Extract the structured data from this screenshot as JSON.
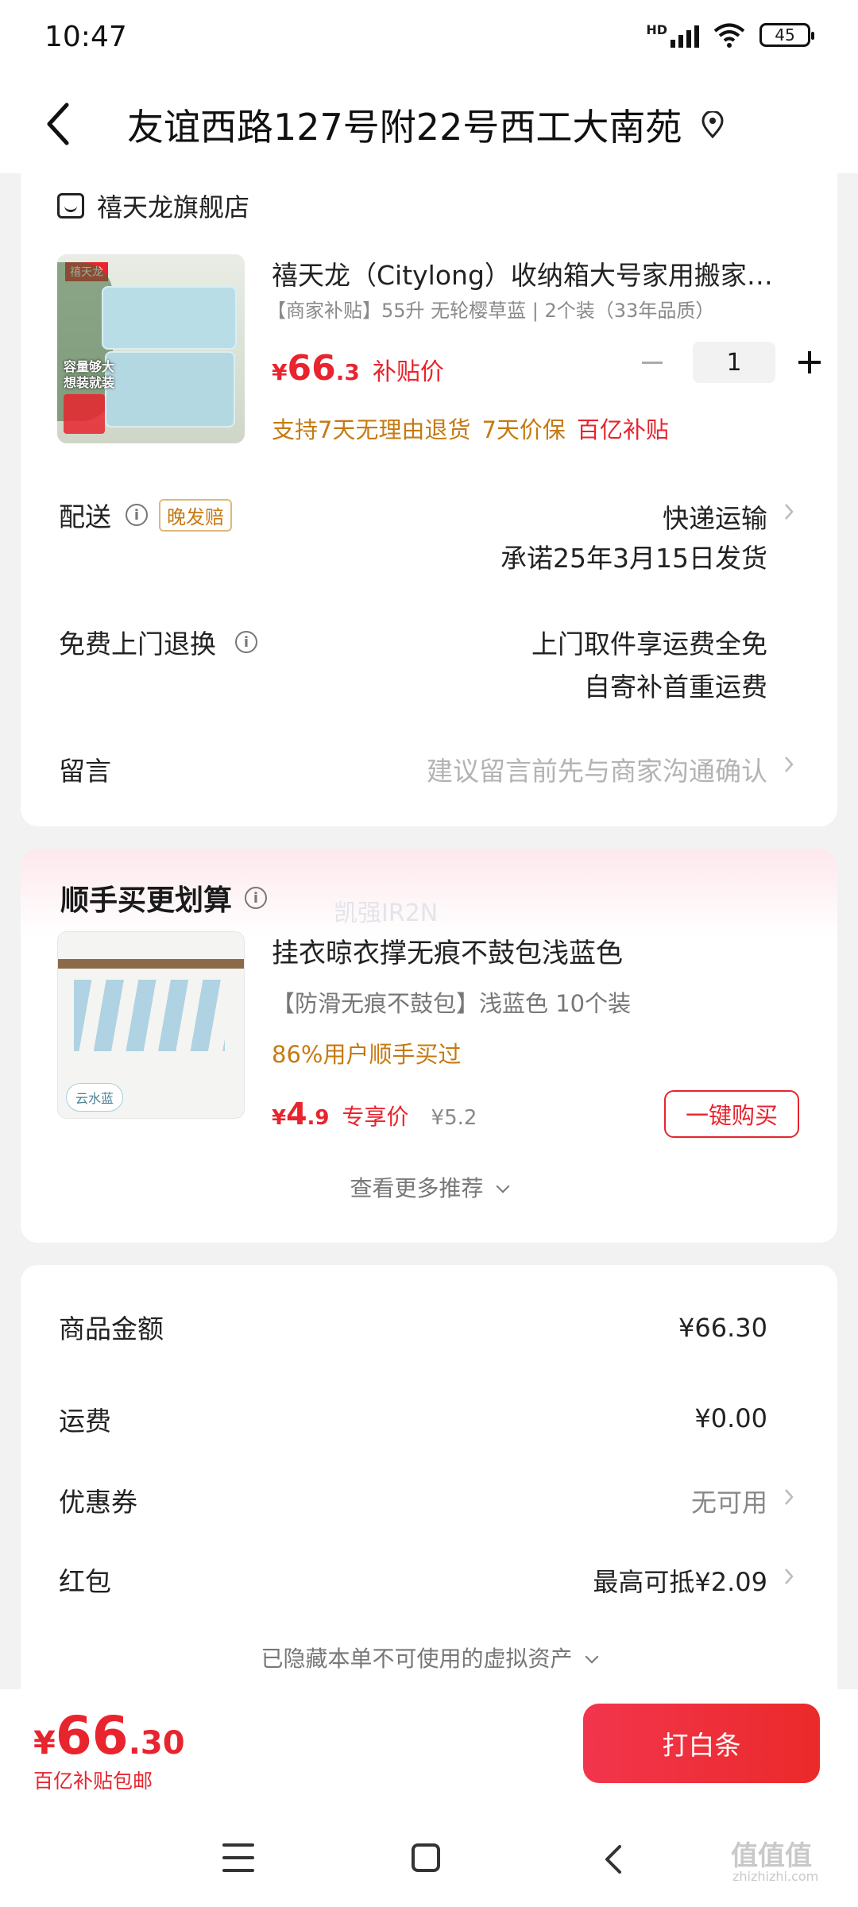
{
  "status_bar": {
    "time": "10:47",
    "network": "HD",
    "battery": "45"
  },
  "header": {
    "title": "友谊西路127号附22号西工大南苑"
  },
  "order": {
    "shop_name": "禧天龙旗舰店",
    "product": {
      "title": "禧天龙（Citylong）收纳箱大号家用搬家…",
      "spec": "【商家补贴】55升 无轮樱草蓝 | 2个装（33年品质）",
      "price_currency": "¥",
      "price_int": "66",
      "price_dec": ".3",
      "price_tag": "补贴价",
      "quantity": "1",
      "services": [
        "支持7天无理由退货",
        "7天价保"
      ],
      "subsidy_label": "百亿补贴",
      "thumb_text": [
        "禧天龙",
        "容量够大",
        "想装就装"
      ]
    },
    "delivery": {
      "label": "配送",
      "tag": "晚发赔",
      "method": "快递运输",
      "promise": "承诺25年3月15日发货"
    },
    "return": {
      "label": "免费上门退换",
      "line1": "上门取件享运费全免",
      "line2": "自寄补首重运费"
    },
    "message": {
      "label": "留言",
      "placeholder": "建议留言前先与商家沟通确认"
    }
  },
  "recommend": {
    "title": "顺手买更划算",
    "watermark": "凯强IR2N",
    "item": {
      "name": "挂衣晾衣撑无痕不鼓包浅蓝色",
      "spec": "【防滑无痕不鼓包】浅蓝色   10个装",
      "bought": "86%用户顺手买过",
      "price_currency": "¥",
      "price_int": "4",
      "price_dec": ".9",
      "price_tag": "专享价",
      "original_price": "¥5.2",
      "buy_label": "一键购买",
      "thumb_badge": "云水蓝"
    },
    "more_label": "查看更多推荐"
  },
  "summary": {
    "goods_label": "商品金额",
    "goods_value": "¥66.30",
    "freight_label": "运费",
    "freight_value": "¥0.00",
    "coupon_label": "优惠券",
    "coupon_value": "无可用",
    "redpacket_label": "红包",
    "redpacket_value": "最高可抵¥2.09",
    "hidden_assets": "已隐藏本单不可使用的虚拟资产"
  },
  "bottom_bar": {
    "total_currency": "¥",
    "total_int": "66",
    "total_dec": ".30",
    "total_note": "百亿补贴包邮",
    "pay_label": "打白条"
  },
  "corner_watermark": {
    "main": "值值值",
    "sub": "zhizhizhi.com"
  },
  "colors": {
    "accent": "#e8242e",
    "service": "#c67a12",
    "background": "#f2f2f2"
  }
}
